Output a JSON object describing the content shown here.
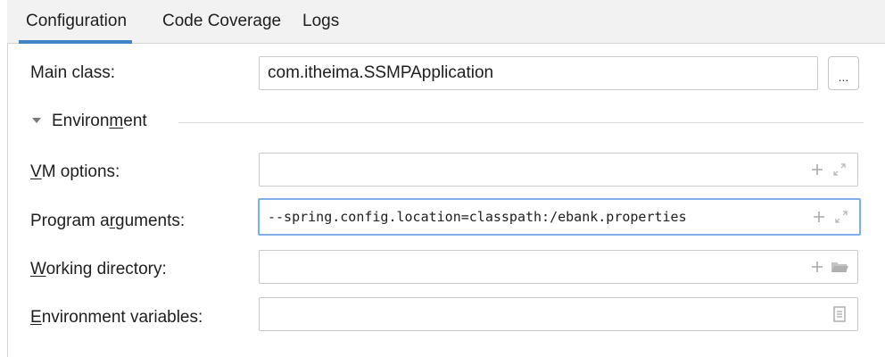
{
  "tabs": [
    {
      "label": "Configuration",
      "active": true
    },
    {
      "label": "Code Coverage",
      "active": false
    },
    {
      "label": "Logs",
      "active": false
    }
  ],
  "main_class": {
    "label": "Main class:",
    "value": "com.itheima.SSMPApplication",
    "browse_label": "..."
  },
  "environment": {
    "header": "Environment",
    "header_mnemonic": "m",
    "expanded": true,
    "rows": {
      "vm_options": {
        "label": "VM options:",
        "mnemonic": "V",
        "value": ""
      },
      "program_arguments": {
        "label": "Program arguments:",
        "mnemonic": "g",
        "value": "--spring.config.location=classpath:/ebank.properties"
      },
      "working_directory": {
        "label": "Working directory:",
        "mnemonic": "W",
        "value": ""
      },
      "environment_variables": {
        "label": "Environment variables:",
        "mnemonic": "E",
        "value": ""
      }
    }
  },
  "colors": {
    "tab_underline": "#4083c9",
    "focus_border": "#80aeea",
    "icon": "#a9a9a9"
  },
  "icons": [
    "plus-icon",
    "expand-icon",
    "folder-icon",
    "document-icon"
  ]
}
